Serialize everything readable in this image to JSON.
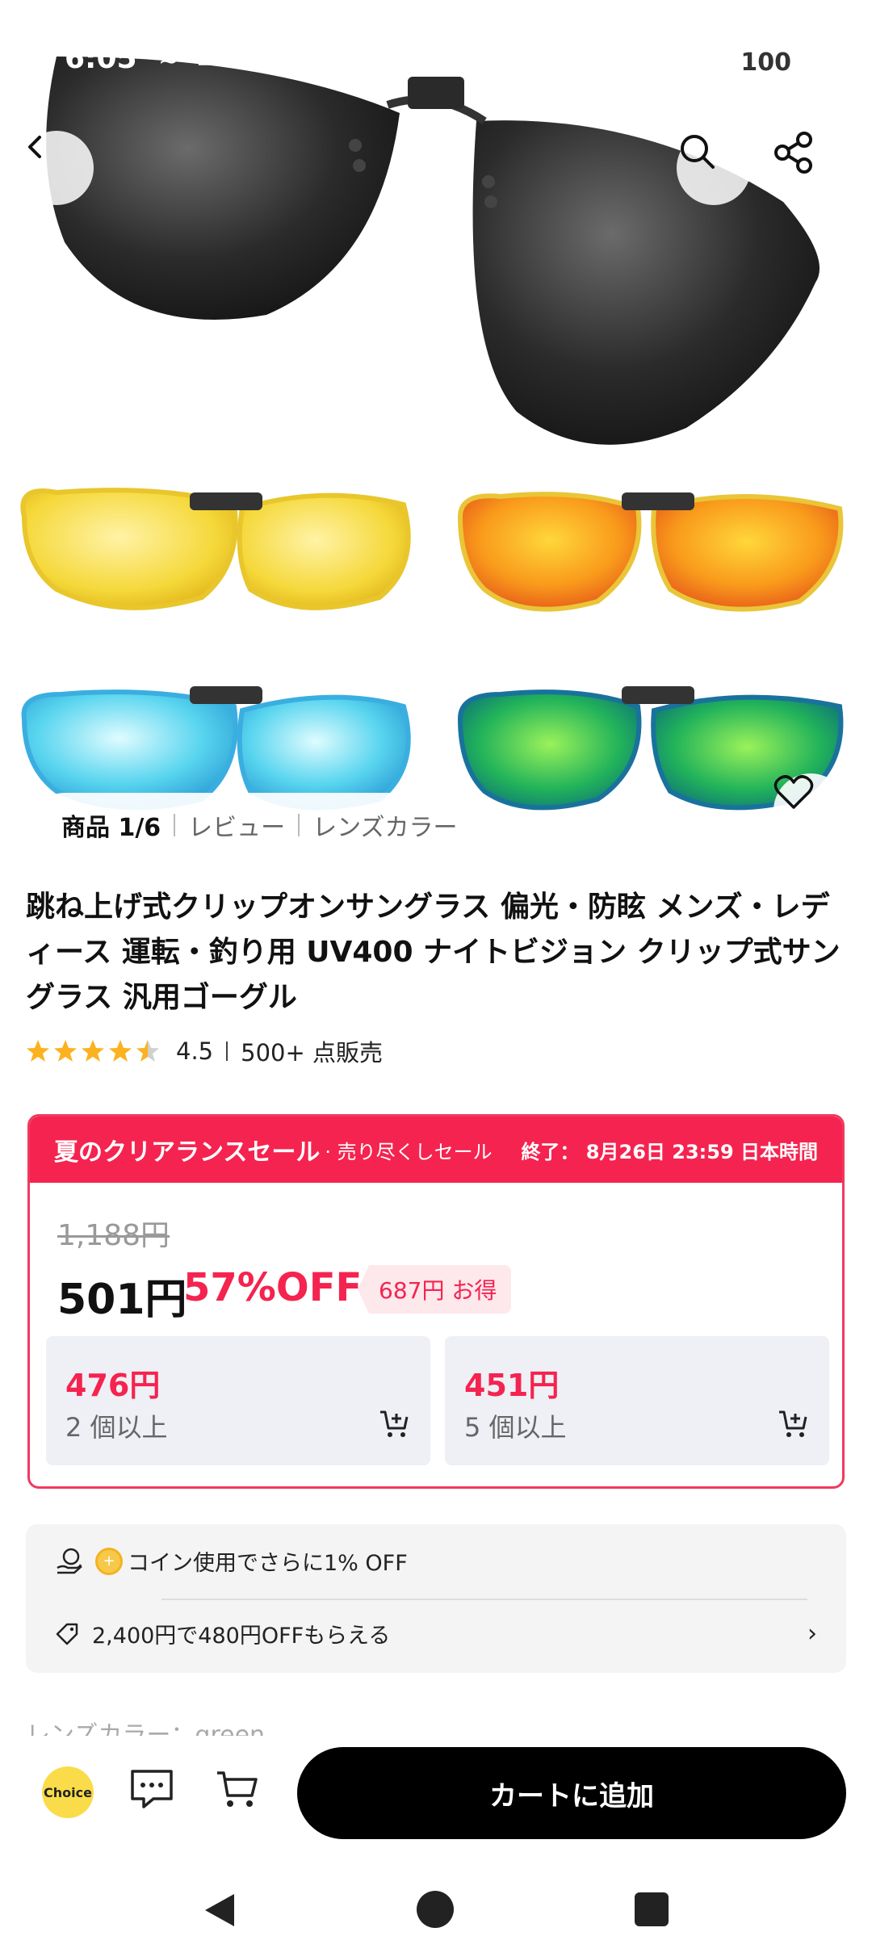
{
  "status_bar": {
    "time": "6:05",
    "battery": "100"
  },
  "gallery": {
    "tab_product": "商品 1/6",
    "tab_review": "レビュー",
    "tab_color": "レンズカラー"
  },
  "product": {
    "title": "跳ね上げ式クリップオンサングラス 偏光・防眩 メンズ・レディース 運転・釣り用 UV400 ナイトビジョン クリップ式サングラス 汎用ゴーグル",
    "rating_value": "4.5",
    "rating_stars": 4.5,
    "sold": "500+ 点販売"
  },
  "sale": {
    "name": "夏のクリアランスセール",
    "subtitle": "· 売り尽くしセール",
    "end": "終了： 8月26日 23:59 日本時間",
    "original_price": "1,188円",
    "price": "501円",
    "discount": "57%OFF",
    "savings": "687円 お得",
    "tiers": [
      {
        "price": "476円",
        "qty": "2 個以上"
      },
      {
        "price": "451円",
        "qty": "5 個以上"
      }
    ]
  },
  "coupons": {
    "coin_text": "コイン使用でさらに1% OFF",
    "coupon_text": "2,400円で480円OFFもらえる"
  },
  "partial_row": "レンズカラー：green",
  "action_bar": {
    "choice_label": "Choice",
    "add_to_cart": "カートに追加"
  },
  "colors": {
    "accent": "#f5234f",
    "tier_bg": "#eef0f6",
    "cta_bg": "#000000"
  }
}
